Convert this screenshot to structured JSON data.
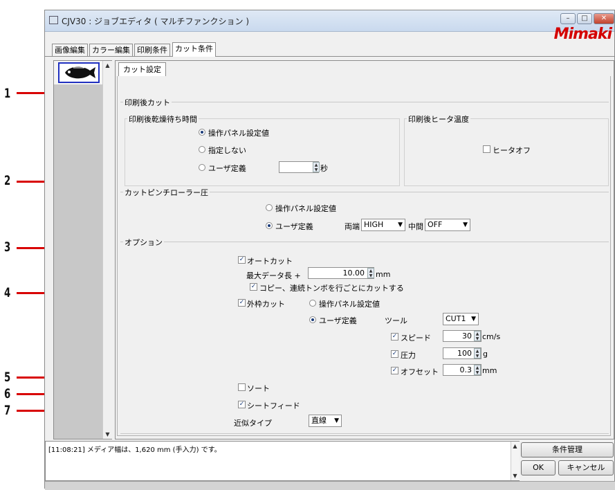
{
  "window": {
    "title": "CJV30 : ジョブエディタ ( マルチファンクション )",
    "logo": "Mimaki",
    "controls": {
      "minimize": "–",
      "maximize": "□",
      "close": "✕"
    }
  },
  "main_tabs": [
    "画像編集",
    "カラー編集",
    "印刷条件",
    "カット条件"
  ],
  "active_tab": "カット条件",
  "sub_tab": "カット設定",
  "post_print_cut": {
    "legend": "印刷後カット",
    "dry_wait": {
      "legend": "印刷後乾燥待ち時間",
      "options": [
        "操作パネル設定値",
        "指定しない",
        "ユーザ定義"
      ],
      "selected": "操作パネル設定値",
      "value": "",
      "unit": "秒"
    },
    "heater": {
      "legend": "印刷後ヒータ温度",
      "heater_off_label": "ヒータオフ",
      "heater_off_checked": false
    }
  },
  "pinch_roller": {
    "legend": "カットピンチローラー圧",
    "options": [
      "操作パネル設定値",
      "ユーザ定義"
    ],
    "selected": "ユーザ定義",
    "both_ends_label": "両端",
    "both_ends_value": "HIGH",
    "middle_label": "中間",
    "middle_value": "OFF"
  },
  "options": {
    "legend": "オプション",
    "auto_cut": {
      "label": "オートカット",
      "checked": true
    },
    "max_data_length": {
      "label": "最大データ長 +",
      "value": "10.00",
      "unit": "mm"
    },
    "copy_cut": {
      "label": "コピー、連続トンボを行ごとにカットする",
      "checked": true
    },
    "outer_frame_cut": {
      "label": "外枠カット",
      "checked": true
    },
    "frame_options": [
      "操作パネル設定値",
      "ユーザ定義"
    ],
    "frame_selected": "ユーザ定義",
    "tool": {
      "label": "ツール",
      "value": "CUT1"
    },
    "speed": {
      "label": "スピード",
      "checked": true,
      "value": "30",
      "unit": "cm/s"
    },
    "pressure": {
      "label": "圧力",
      "checked": true,
      "value": "100",
      "unit": "g"
    },
    "offset": {
      "label": "オフセット",
      "checked": true,
      "value": "0.3",
      "unit": "mm"
    },
    "sort": {
      "label": "ソート",
      "checked": false
    },
    "sheet_feed": {
      "label": "シートフィード",
      "checked": true
    },
    "approx_type": {
      "label": "近似タイプ",
      "value": "直線"
    }
  },
  "log": {
    "message": "[11:08:21] メディア幅は、1,620 mm (手入力) です。"
  },
  "buttons": {
    "condition_manage": "条件管理",
    "ok": "OK",
    "cancel": "キャンセル"
  },
  "callouts": [
    "1",
    "2",
    "3",
    "4",
    "5",
    "6",
    "7"
  ],
  "colors": {
    "callout_line": "#d80000",
    "logo": "#d40000",
    "selection": "#1a3c7a"
  }
}
